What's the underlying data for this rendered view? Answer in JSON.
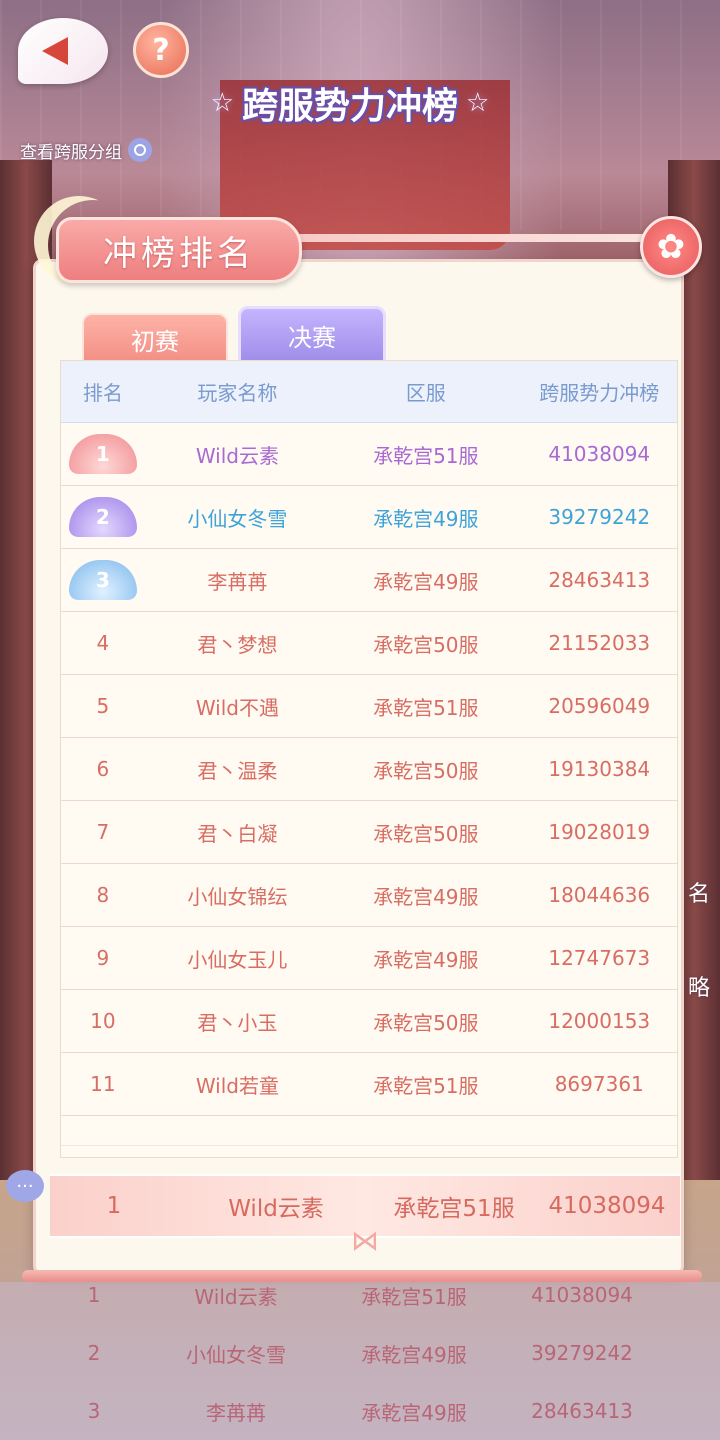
{
  "header": {
    "title": "跨服势力冲榜",
    "group_link": "查看跨服分组",
    "help_label": "?"
  },
  "panel": {
    "tag": "冲榜排名",
    "tabs": [
      {
        "label": "初赛",
        "active": false
      },
      {
        "label": "决赛",
        "active": true
      }
    ],
    "columns": [
      "排名",
      "玩家名称",
      "区服",
      "跨服势力冲榜"
    ],
    "rows": [
      {
        "rank": "1",
        "name": "Wild云素",
        "server": "承乾宫51服",
        "score": "41038094"
      },
      {
        "rank": "2",
        "name": "小仙女冬雪",
        "server": "承乾宫49服",
        "score": "39279242"
      },
      {
        "rank": "3",
        "name": "李苒苒",
        "server": "承乾宫49服",
        "score": "28463413"
      },
      {
        "rank": "4",
        "name": "君丶梦想",
        "server": "承乾宫50服",
        "score": "21152033"
      },
      {
        "rank": "5",
        "name": "Wild不遇",
        "server": "承乾宫51服",
        "score": "20596049"
      },
      {
        "rank": "6",
        "name": "君丶温柔",
        "server": "承乾宫50服",
        "score": "19130384"
      },
      {
        "rank": "7",
        "name": "君丶白凝",
        "server": "承乾宫50服",
        "score": "19028019"
      },
      {
        "rank": "8",
        "name": "小仙女锦纭",
        "server": "承乾宫49服",
        "score": "18044636"
      },
      {
        "rank": "9",
        "name": "小仙女玉儿",
        "server": "承乾宫49服",
        "score": "12747673"
      },
      {
        "rank": "10",
        "name": "君丶小玉",
        "server": "承乾宫50服",
        "score": "12000153"
      },
      {
        "rank": "11",
        "name": "Wild若童",
        "server": "承乾宫51服",
        "score": "8697361"
      }
    ]
  },
  "my_rank": {
    "rank": "1",
    "name": "Wild云素",
    "server": "承乾宫51服",
    "score": "41038094"
  },
  "background_list": [
    {
      "rank": "1",
      "name": "Wild云素",
      "server": "承乾宫51服",
      "score": "41038094"
    },
    {
      "rank": "2",
      "name": "小仙女冬雪",
      "server": "承乾宫49服",
      "score": "39279242"
    },
    {
      "rank": "3",
      "name": "李苒苒",
      "server": "承乾宫49服",
      "score": "28463413"
    }
  ],
  "side_labels": {
    "name_char": "名",
    "strategy_char": "略"
  },
  "colors": {
    "rank1": "#a86ad2",
    "rank2": "#3ea3d8",
    "default": "#d86e63",
    "header_text": "#7a9bcf"
  }
}
